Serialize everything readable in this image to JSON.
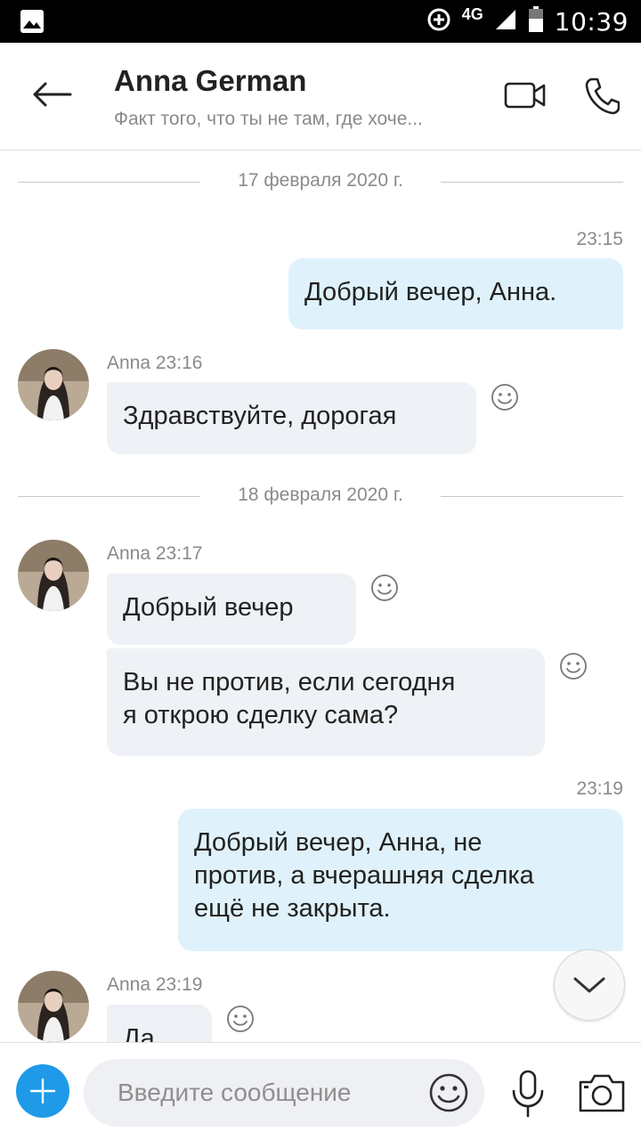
{
  "status_bar": {
    "network": "4G",
    "time": "10:39"
  },
  "header": {
    "contact_name": "Anna German",
    "contact_status": "Факт того, что ты не там, где хоче..."
  },
  "chat": {
    "date_1": "17 февраля 2020 г.",
    "out_1_time": "23:15",
    "out_1_text": "Добрый вечер, Анна.",
    "in_1_meta": "Anna 23:16",
    "in_1_text": "Здравствуйте, дорогая",
    "date_2": "18 февраля 2020 г.",
    "in_2_meta": "Anna 23:17",
    "in_2_text_a": "Добрый вечер",
    "in_2_text_b_line1": "Вы не против, если сегодня",
    "in_2_text_b_line2": "я открою сделку сама?",
    "out_2_time": "23:19",
    "out_2_line1": "Добрый вечер, Анна, не",
    "out_2_line2": "против, а вчерашняя сделка",
    "out_2_line3": "ещё не закрыта.",
    "in_3_meta": "Anna 23:19",
    "in_3_text": "Да"
  },
  "composer": {
    "placeholder": "Введите сообщение"
  },
  "icons": {
    "back": "arrow-left-icon",
    "video": "video-camera-icon",
    "call": "phone-icon",
    "reaction": "smiley-icon",
    "scroll": "chevron-down-icon",
    "add": "plus-icon",
    "emoji": "smiley-icon",
    "mic": "microphone-icon",
    "camera": "camera-icon"
  },
  "colors": {
    "accent": "#1e9ae8",
    "outgoing_bubble": "#dff2fb",
    "incoming_bubble": "#eef1f5"
  }
}
